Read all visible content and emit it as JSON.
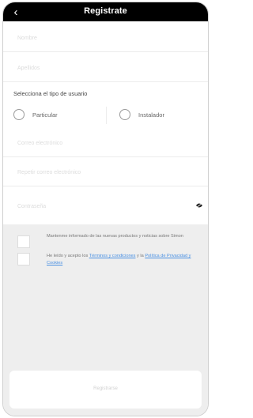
{
  "header": {
    "title": "Registrate",
    "back_icon": "‹"
  },
  "fields": [
    {
      "placeholder": "Nombre"
    },
    {
      "placeholder": "Apellidos"
    }
  ],
  "user_type": {
    "label": "Selecciona el tipo de usuario",
    "options": [
      "Particular",
      "Instalador"
    ]
  },
  "fields2": [
    {
      "placeholder": "Correo electrónico"
    },
    {
      "placeholder": "Repetir correo electrónico"
    },
    {
      "placeholder": "Contraseña"
    }
  ],
  "password_toggle_icon": "eye-icon",
  "consent": {
    "newsletter_text": "Mantenme informado de las nuevas productos y noticias sobre Simon",
    "terms_prefix": "He leído y acepto los",
    "terms_link": "Términos y condiciones",
    "terms_middle": "y la",
    "privacy_link": "Política de Privacidad y Cookies",
    "link_color": "#4a90e2"
  },
  "submit_label": "Registrarse"
}
